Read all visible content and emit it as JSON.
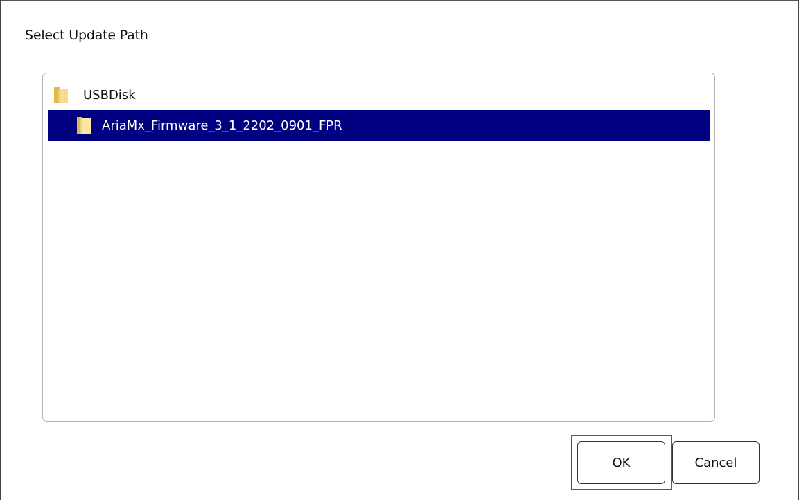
{
  "dialog": {
    "title": "Select Update Path"
  },
  "tree": {
    "root": {
      "label": "USBDisk",
      "icon": "folder-icon"
    },
    "children": [
      {
        "label": "AriaMx_Firmware_3_1_2202_0901_FPR",
        "icon": "folder-icon",
        "selected": true
      }
    ],
    "selection_color": "#000080"
  },
  "buttons": {
    "ok_label": "OK",
    "cancel_label": "Cancel"
  },
  "highlight": {
    "target": "ok-button",
    "color": "#d0243a"
  }
}
